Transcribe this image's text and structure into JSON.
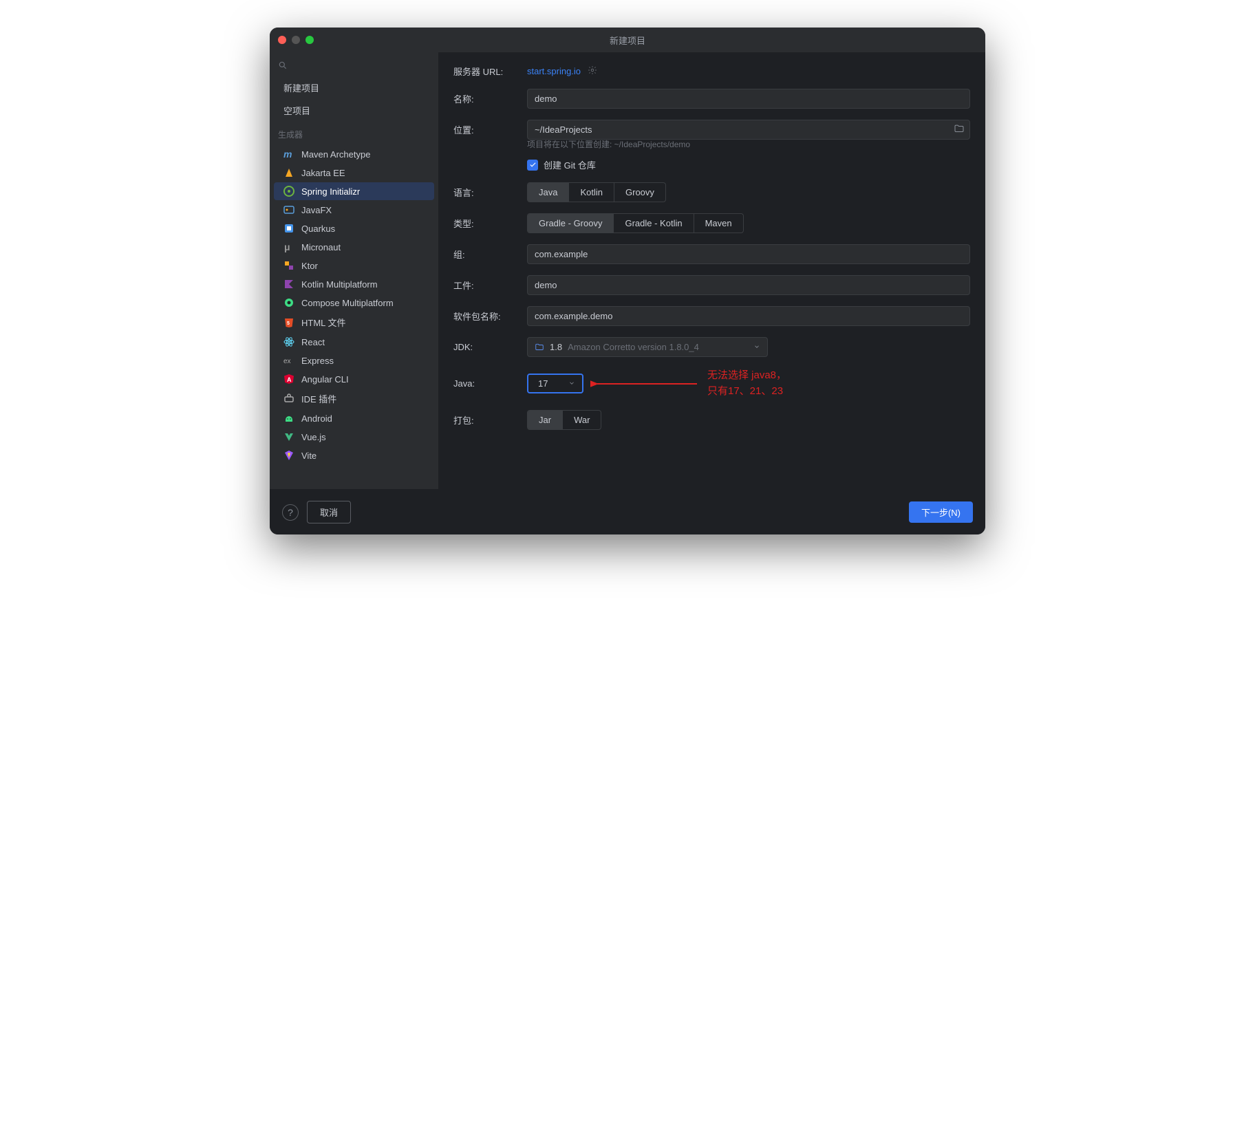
{
  "title": "新建项目",
  "sidebar": {
    "items_top": [
      {
        "label": "新建项目"
      },
      {
        "label": "空项目"
      }
    ],
    "section_label": "生成器",
    "generators": [
      {
        "label": "Maven Archetype",
        "icon": "maven"
      },
      {
        "label": "Jakarta EE",
        "icon": "jakarta"
      },
      {
        "label": "Spring Initializr",
        "icon": "spring",
        "selected": true
      },
      {
        "label": "JavaFX",
        "icon": "javafx"
      },
      {
        "label": "Quarkus",
        "icon": "quarkus"
      },
      {
        "label": "Micronaut",
        "icon": "micronaut"
      },
      {
        "label": "Ktor",
        "icon": "ktor"
      },
      {
        "label": "Kotlin Multiplatform",
        "icon": "kotlin"
      },
      {
        "label": "Compose Multiplatform",
        "icon": "compose"
      },
      {
        "label": "HTML 文件",
        "icon": "html"
      },
      {
        "label": "React",
        "icon": "react"
      },
      {
        "label": "Express",
        "icon": "express"
      },
      {
        "label": "Angular CLI",
        "icon": "angular"
      },
      {
        "label": "IDE 插件",
        "icon": "ide"
      },
      {
        "label": "Android",
        "icon": "android"
      },
      {
        "label": "Vue.js",
        "icon": "vue"
      },
      {
        "label": "Vite",
        "icon": "vite"
      }
    ]
  },
  "form": {
    "server_url_label": "服务器 URL:",
    "server_url_value": "start.spring.io",
    "name_label": "名称:",
    "name_value": "demo",
    "location_label": "位置:",
    "location_value": "~/IdeaProjects",
    "location_hint": "项目将在以下位置创建: ~/IdeaProjects/demo",
    "create_git_label": "创建 Git 仓库",
    "language_label": "语言:",
    "language_options": [
      "Java",
      "Kotlin",
      "Groovy"
    ],
    "language_selected": "Java",
    "type_label": "类型:",
    "type_options": [
      "Gradle - Groovy",
      "Gradle - Kotlin",
      "Maven"
    ],
    "type_selected": "Gradle - Groovy",
    "group_label": "组:",
    "group_value": "com.example",
    "artifact_label": "工件:",
    "artifact_value": "demo",
    "package_label": "软件包名称:",
    "package_value": "com.example.demo",
    "jdk_label": "JDK:",
    "jdk_version": "1.8",
    "jdk_desc": "Amazon Corretto version 1.8.0_4",
    "java_label": "Java:",
    "java_value": "17",
    "packaging_label": "打包:",
    "packaging_options": [
      "Jar",
      "War"
    ],
    "packaging_selected": "Jar"
  },
  "annotation": {
    "line1": "无法选择 java8，",
    "line2": "只有17、21、23"
  },
  "footer": {
    "cancel": "取消",
    "next": "下一步(N)"
  }
}
